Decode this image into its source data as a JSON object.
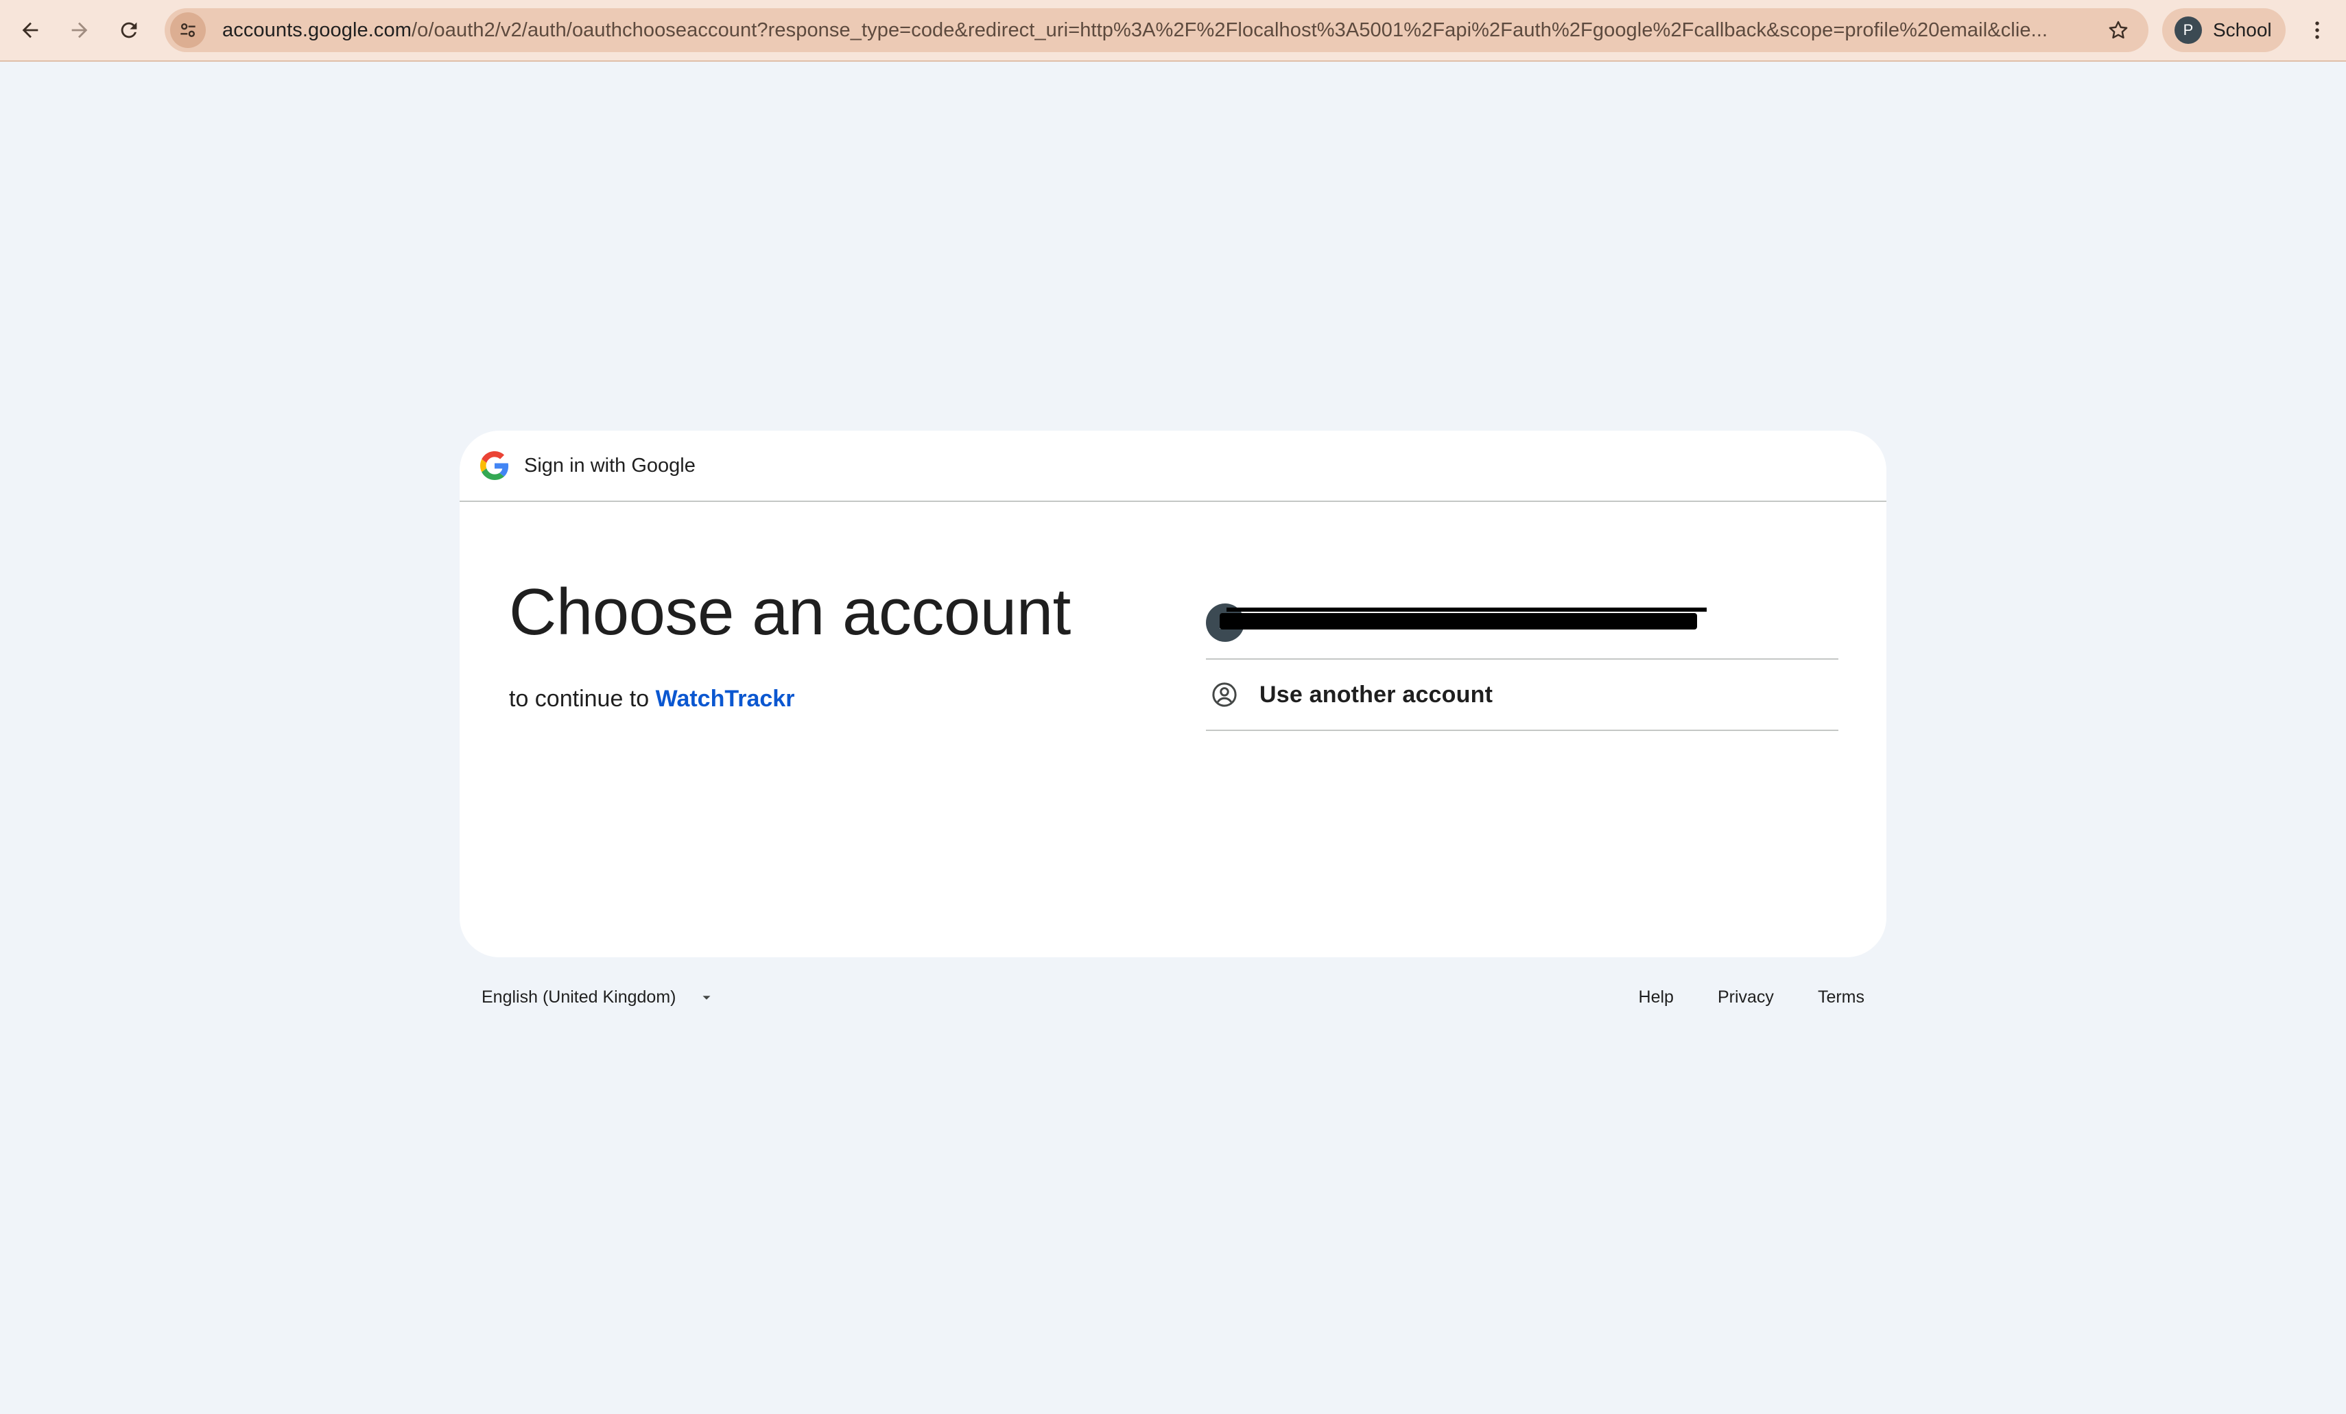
{
  "browser": {
    "url_host": "accounts.google.com",
    "url_rest": "/o/oauth2/v2/auth/oauthchooseaccount?response_type=code&redirect_uri=http%3A%2F%2Flocalhost%3A5001%2Fapi%2Fauth%2Fgoogle%2Fcallback&scope=profile%20email&clie...",
    "profile_initial": "P",
    "profile_label": "School",
    "colors": {
      "toolbar": "#f7e5da",
      "omnibox": "#eccab5"
    }
  },
  "card": {
    "header_title": "Sign in with Google",
    "headline": "Choose an account",
    "subtitle_prefix": "to continue to ",
    "app_name": "WatchTrackr",
    "accounts": [
      {
        "avatar_initial": "P"
      }
    ],
    "use_another_label": "Use another account"
  },
  "footer": {
    "language": "English (United Kingdom)",
    "links": [
      "Help",
      "Privacy",
      "Terms"
    ]
  },
  "icons": {
    "back": "back-arrow-icon",
    "forward": "forward-arrow-icon",
    "reload": "reload-icon",
    "site_info": "tune-icon",
    "bookmark": "star-icon",
    "menu": "kebab-menu-icon",
    "google": "google-g-icon",
    "use_another": "account-circle-icon",
    "lang_caret": "caret-down-icon"
  }
}
